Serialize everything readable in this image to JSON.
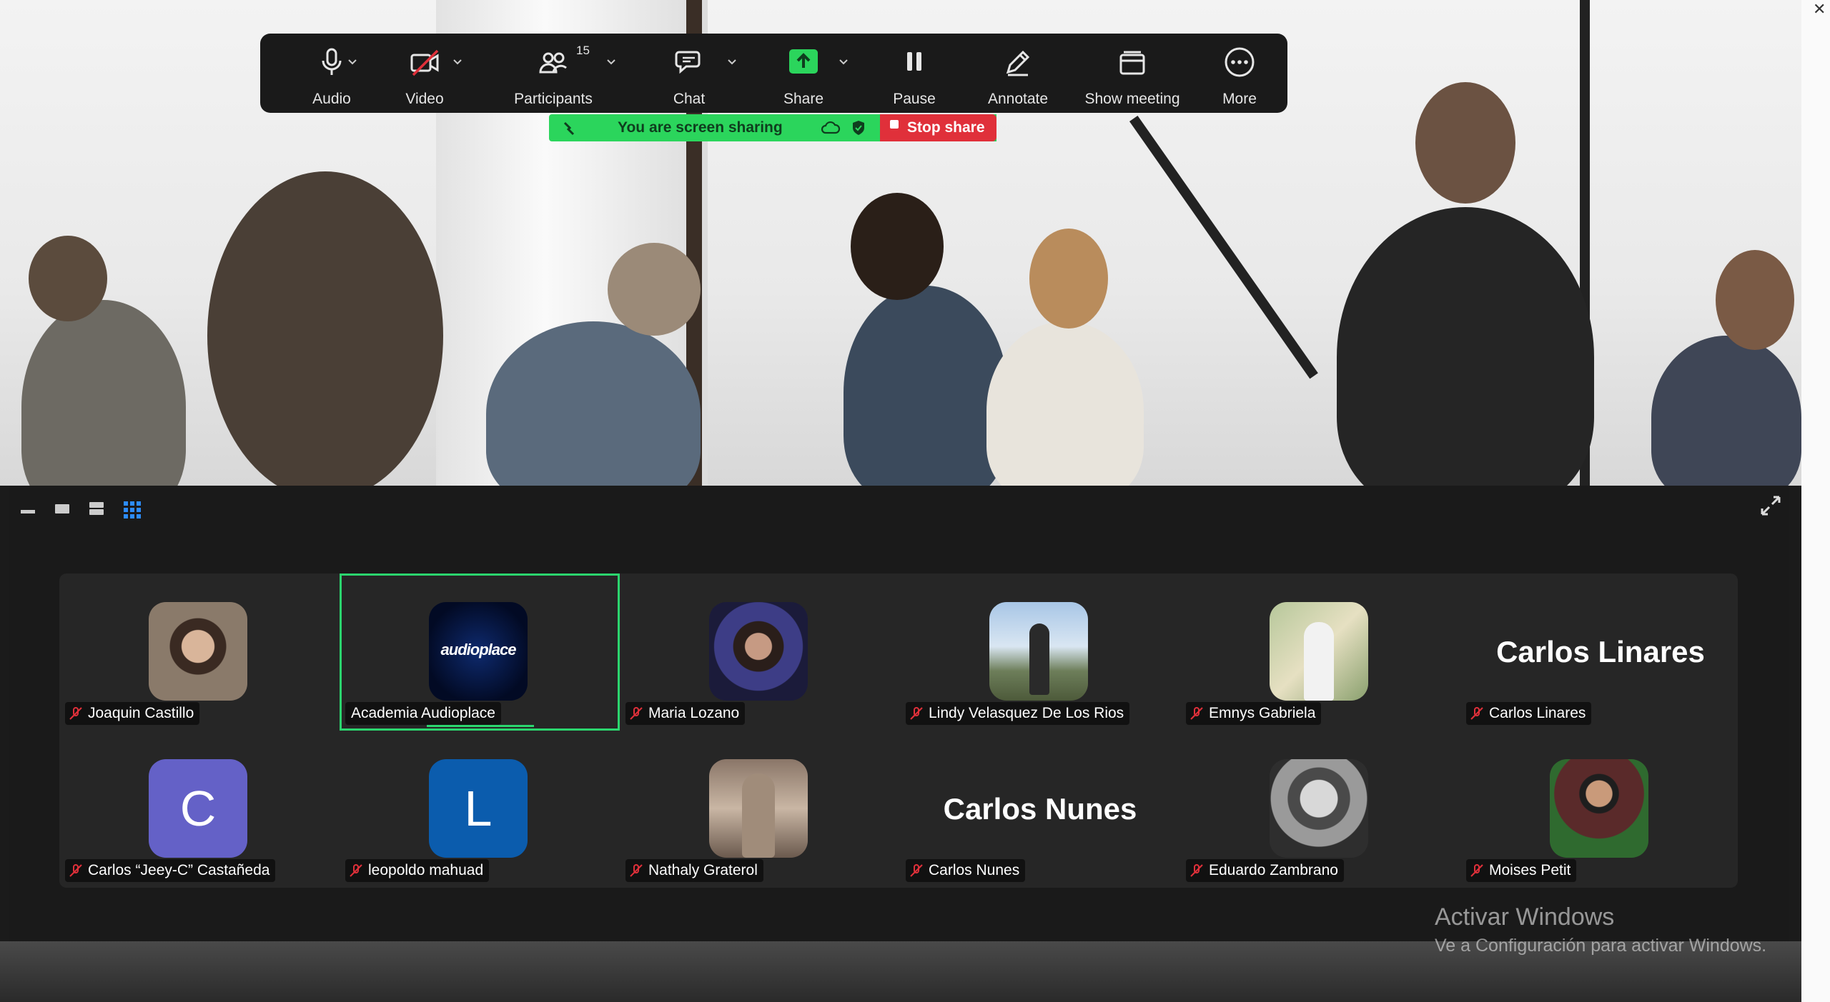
{
  "toolbar": {
    "audio_label": "Audio",
    "video_label": "Video",
    "participants_label": "Participants",
    "participants_count": "15",
    "chat_label": "Chat",
    "share_label": "Share",
    "pause_label": "Pause",
    "annotate_label": "Annotate",
    "show_meeting_label": "Show meeting",
    "more_label": "More"
  },
  "share_banner": {
    "status_text": "You are screen sharing",
    "stop_label": "Stop share"
  },
  "colors": {
    "toolbar_bg": "#1a1a1a",
    "banner_green": "#2bd55c",
    "stop_red": "#e0303a",
    "active_outline": "#2bd56e",
    "mic_muted_red": "#e0303a",
    "view_active_blue": "#2d8cff"
  },
  "participants": [
    {
      "name": "Joaquin Castillo",
      "muted": true,
      "avatar": "photo"
    },
    {
      "name": "Academia Audioplace",
      "muted": false,
      "avatar": "logo",
      "logo_text": "audioplace",
      "active": true
    },
    {
      "name": "Maria Lozano",
      "muted": true,
      "avatar": "photo"
    },
    {
      "name": "Lindy Velasquez De Los Rios",
      "muted": true,
      "avatar": "photo"
    },
    {
      "name": "Emnys Gabriela",
      "muted": true,
      "avatar": "photo"
    },
    {
      "name": "Carlos Linares",
      "muted": true,
      "avatar": "text",
      "display_text": "Carlos Linares"
    },
    {
      "name": "Carlos “Jeey-C” Castañeda",
      "muted": true,
      "avatar": "letter",
      "letter": "C",
      "color": "#6461c7"
    },
    {
      "name": "leopoldo mahuad",
      "muted": true,
      "avatar": "letter",
      "letter": "L",
      "color": "#0b5cad"
    },
    {
      "name": "Nathaly Graterol",
      "muted": true,
      "avatar": "photo"
    },
    {
      "name": "Carlos Nunes",
      "muted": true,
      "avatar": "text",
      "display_text": "Carlos Nunes"
    },
    {
      "name": "Eduardo Zambrano",
      "muted": true,
      "avatar": "photo"
    },
    {
      "name": "Moises Petit",
      "muted": true,
      "avatar": "photo"
    }
  ],
  "watermark": {
    "title": "Activar Windows",
    "subtitle": "Ve a Configuración para activar Windows."
  }
}
